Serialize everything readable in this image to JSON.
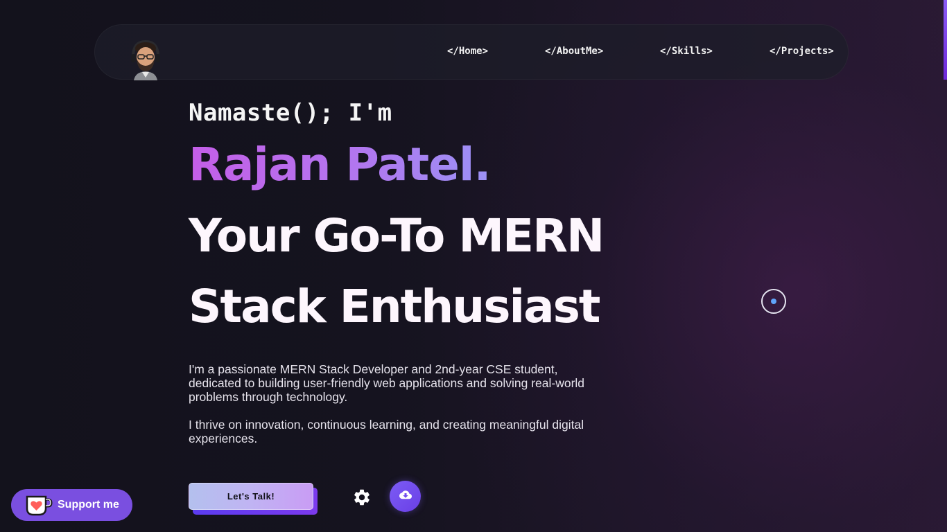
{
  "nav": {
    "avatar_alt": "avatar",
    "links": [
      {
        "label": "</Home>"
      },
      {
        "label": "</AboutMe>"
      },
      {
        "label": "</Skills>"
      },
      {
        "label": "</Projects>"
      }
    ]
  },
  "hero": {
    "greeting": "Namaste(); I'm",
    "name": "Rajan Patel.",
    "role_line1": "Your Go-To MERN",
    "role_line2": "Stack Enthusiast",
    "bio_p1": "I'm a passionate MERN Stack Developer and 2nd-year CSE student, dedicated to building user-friendly web applications and solving real-world problems through technology.",
    "bio_p2": "I thrive on innovation, continuous learning, and creating meaningful digital experiences."
  },
  "actions": {
    "talk_label": "Let's Talk!",
    "settings_icon": "gear-icon",
    "download_icon": "cloud-download-icon"
  },
  "support": {
    "label": "Support me",
    "icon": "kofi-cup-icon"
  },
  "colors": {
    "accent": "#7c5cf5",
    "name_gradient_start": "#c45ee8",
    "name_gradient_end": "#9b91f5",
    "cursor_dot": "#60a5fa"
  }
}
